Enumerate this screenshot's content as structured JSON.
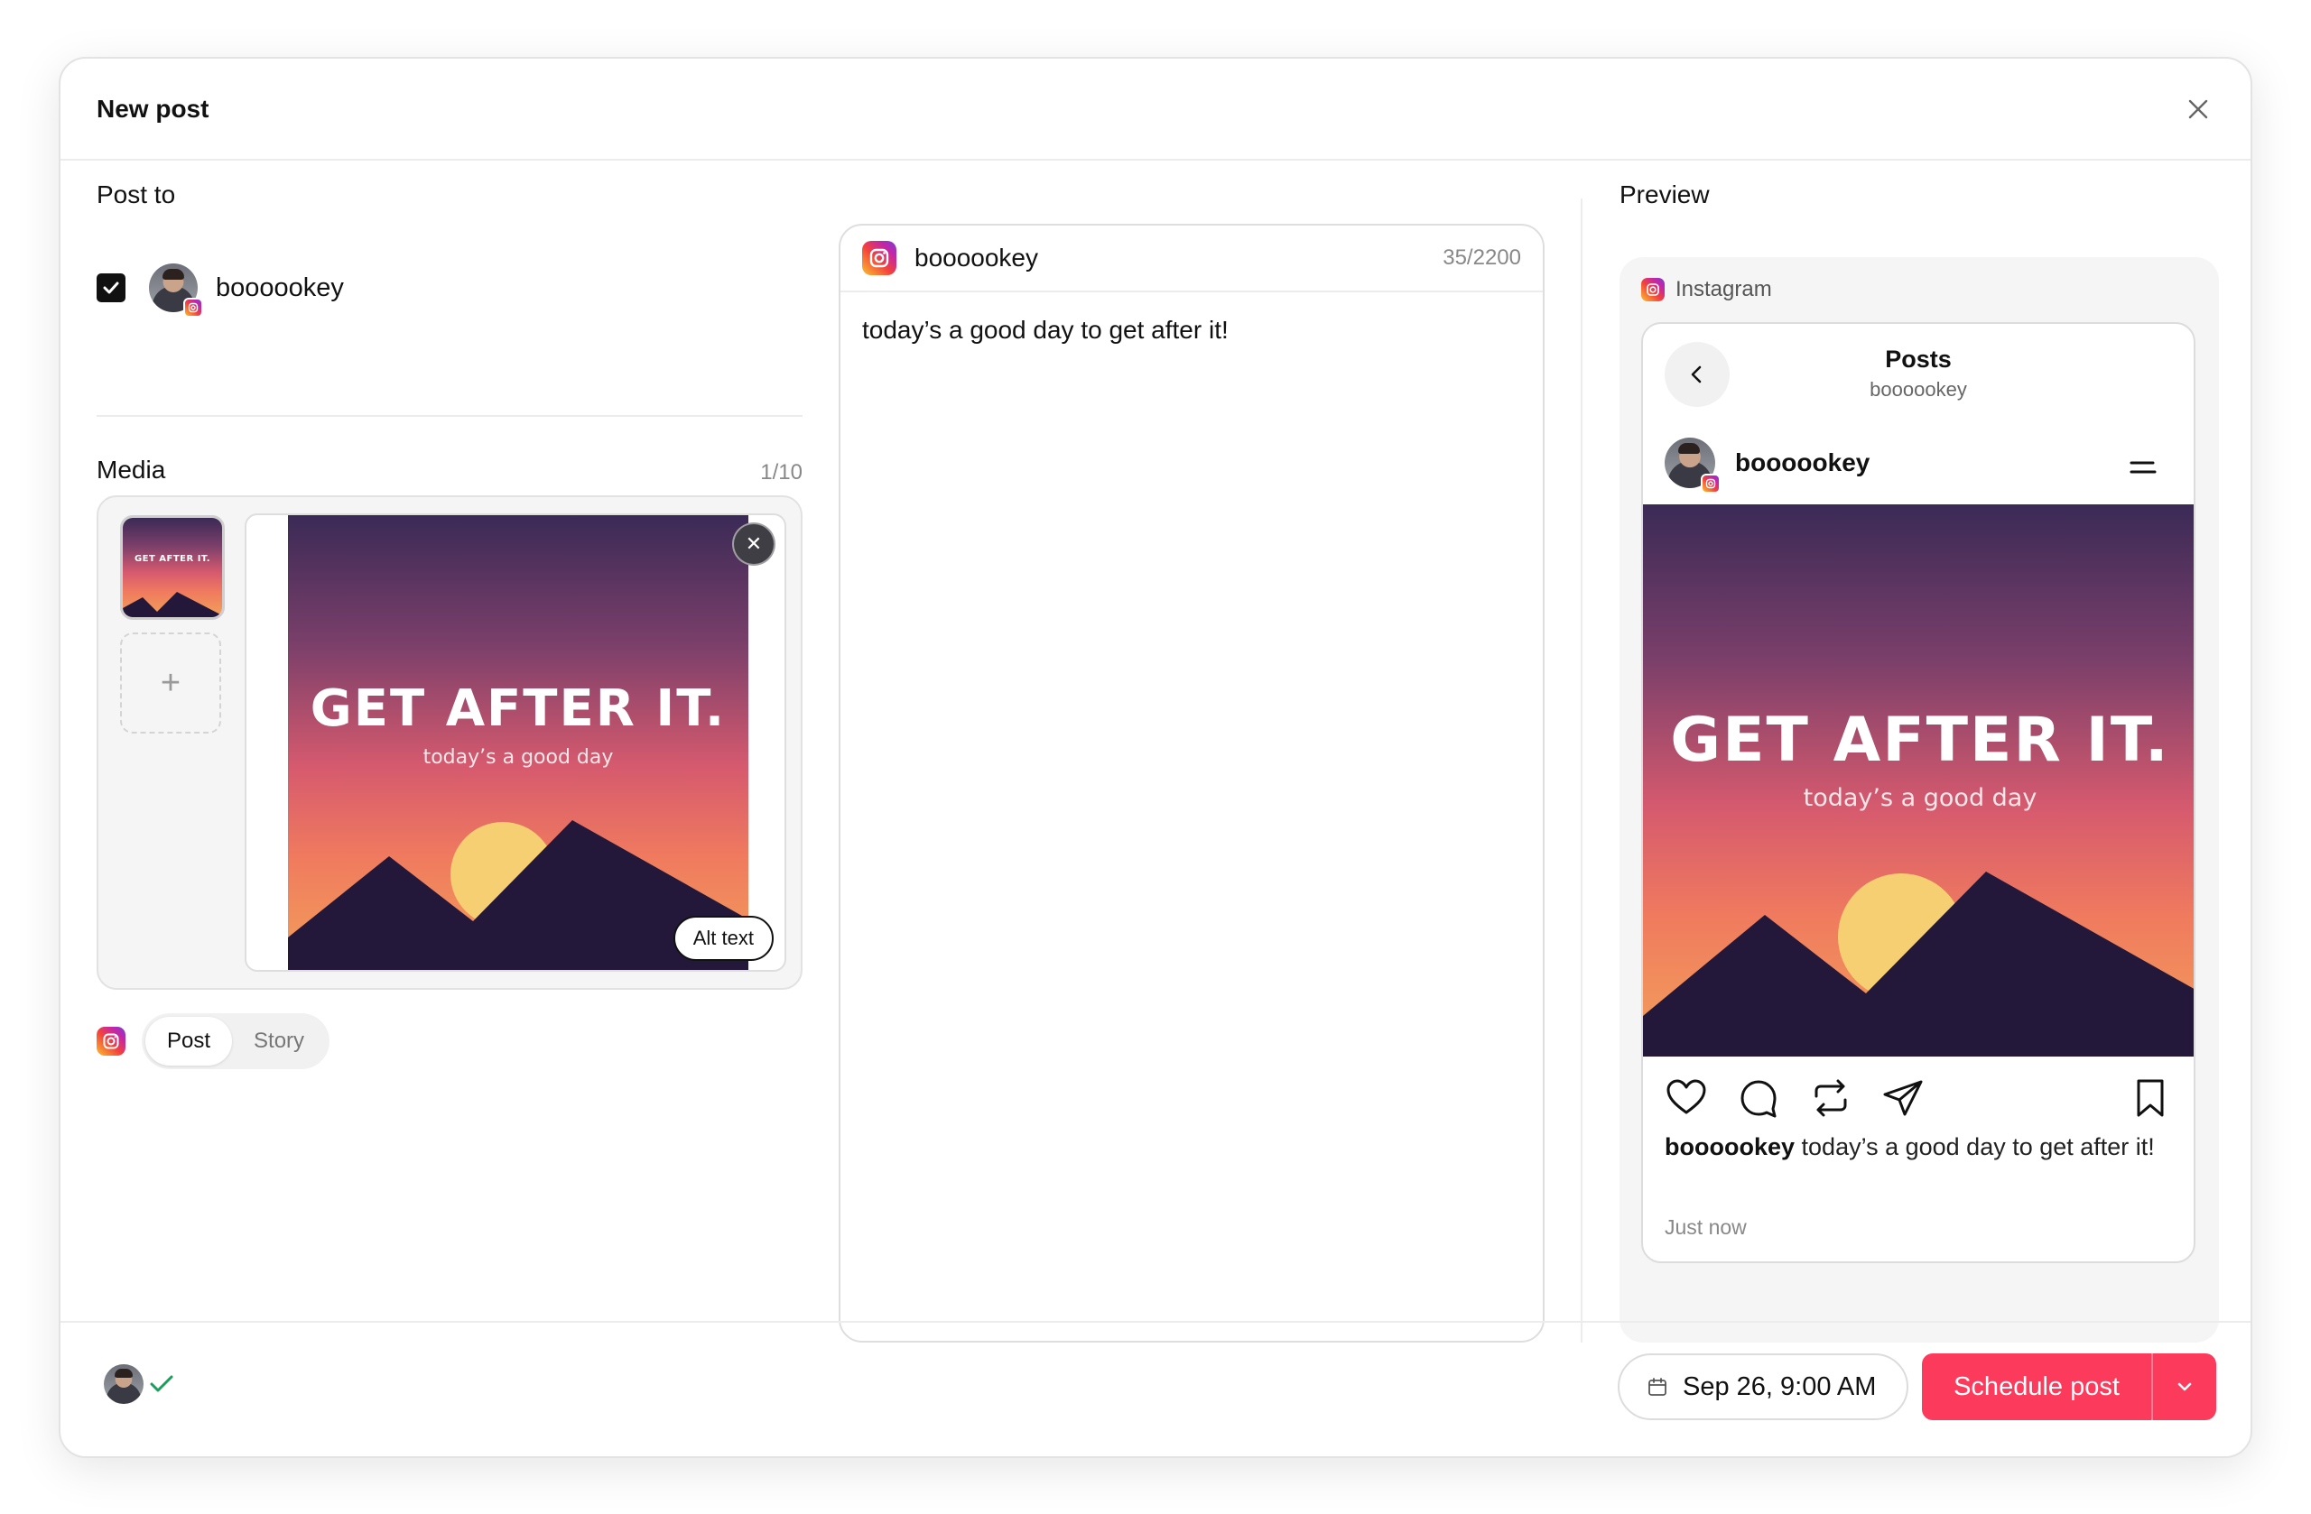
{
  "dialog": {
    "title": "New post"
  },
  "post_to": {
    "label": "Post to",
    "account": {
      "name": "boooookey",
      "checked": true,
      "platform": "instagram-icon"
    }
  },
  "media": {
    "label": "Media",
    "count": "1/10",
    "image": {
      "headline": "GET AFTER IT.",
      "subtitle": "today’s a good day"
    },
    "alt_text_label": "Alt text"
  },
  "post_type": {
    "options": [
      "Post",
      "Story"
    ],
    "selected": "Post"
  },
  "editor": {
    "account": "boooookey",
    "char_count": "35/2200",
    "text": "today’s a good day to get after it!"
  },
  "preview": {
    "label": "Preview",
    "platform": "Instagram",
    "screen_title": "Posts",
    "screen_subtitle": "boooookey",
    "username": "boooookey",
    "caption_user": "boooookey",
    "caption_text": "today’s a good day to get after it!",
    "timestamp": "Just now"
  },
  "footer": {
    "date": "Sep 26, 9:00 AM",
    "schedule_label": "Schedule post"
  },
  "colors": {
    "accent": "#fb3a5c",
    "check": "#1a9e5a"
  }
}
